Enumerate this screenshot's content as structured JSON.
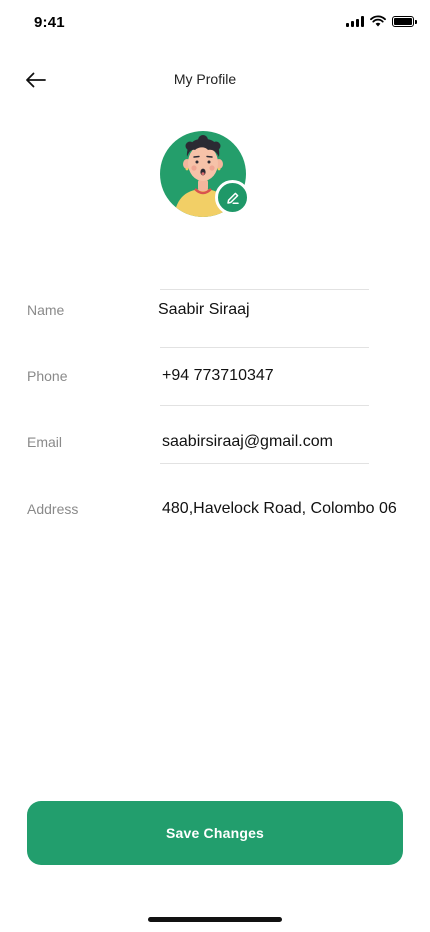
{
  "status_bar": {
    "time": "9:41",
    "icons": [
      "signal-icon",
      "wifi-icon",
      "battery-icon"
    ]
  },
  "header": {
    "title": "My Profile",
    "back_icon": "arrow-left-icon"
  },
  "avatar": {
    "background_color": "#249e6b",
    "edit_icon": "pencil-icon"
  },
  "form": {
    "fields": [
      {
        "label": "Name",
        "value": "Saabir Siraaj"
      },
      {
        "label": "Phone",
        "value": "+94 773710347"
      },
      {
        "label": "Email",
        "value": "saabirsiraaj@gmail.com"
      },
      {
        "label": "Address",
        "value": "480,Havelock Road, Colombo 06"
      }
    ]
  },
  "actions": {
    "save_label": "Save Changes"
  },
  "colors": {
    "accent": "#229e6d",
    "label_gray": "#8a8a8a",
    "divider": "#e2e2e2"
  }
}
